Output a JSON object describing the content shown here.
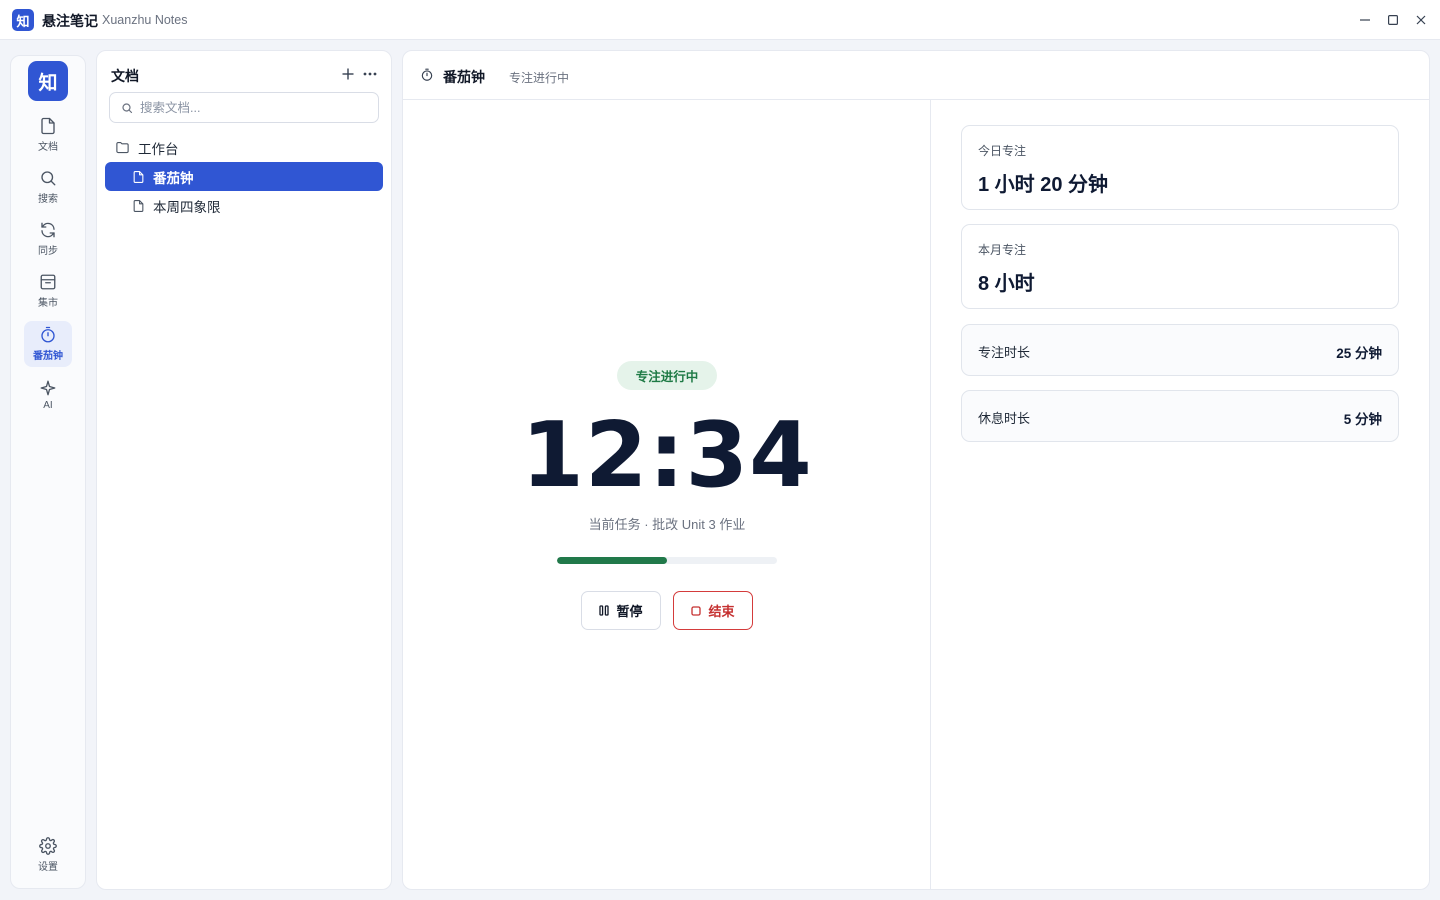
{
  "window": {
    "logo_char": "知",
    "app_name": "悬注笔记",
    "app_subtitle": "Xuanzhu Notes"
  },
  "rail": {
    "logo_char": "知",
    "items": [
      {
        "label": "文档",
        "icon": "document-icon"
      },
      {
        "label": "搜索",
        "icon": "search-icon"
      },
      {
        "label": "同步",
        "icon": "sync-icon"
      },
      {
        "label": "集市",
        "icon": "market-icon"
      },
      {
        "label": "番茄钟",
        "icon": "timer-icon",
        "active": true
      },
      {
        "label": "AI",
        "icon": "sparkle-icon"
      }
    ],
    "settings_label": "设置"
  },
  "docs": {
    "title": "文档",
    "search_placeholder": "搜索文档...",
    "search_value": "",
    "folder": "工作台",
    "items": [
      {
        "label": "番茄钟",
        "active": true
      },
      {
        "label": "本周四象限",
        "active": false
      }
    ]
  },
  "main": {
    "title": "番茄钟",
    "status": "专注进行中"
  },
  "timer": {
    "badge": "专注进行中",
    "time": "12:34",
    "task": "当前任务 · 批改 Unit 3 作业",
    "progress_percent": 50,
    "pause_label": "暂停",
    "stop_label": "结束"
  },
  "stats": {
    "today_label": "今日专注",
    "today_value": "1 小时 20 分钟",
    "month_label": "本月专注",
    "month_value": "8 小时",
    "focus_label": "专注时长",
    "focus_value": "25 分钟",
    "rest_label": "休息时长",
    "rest_value": "5 分钟"
  },
  "colors": {
    "accent": "#3056d3",
    "success": "#21794a",
    "danger": "#d43b3b"
  }
}
